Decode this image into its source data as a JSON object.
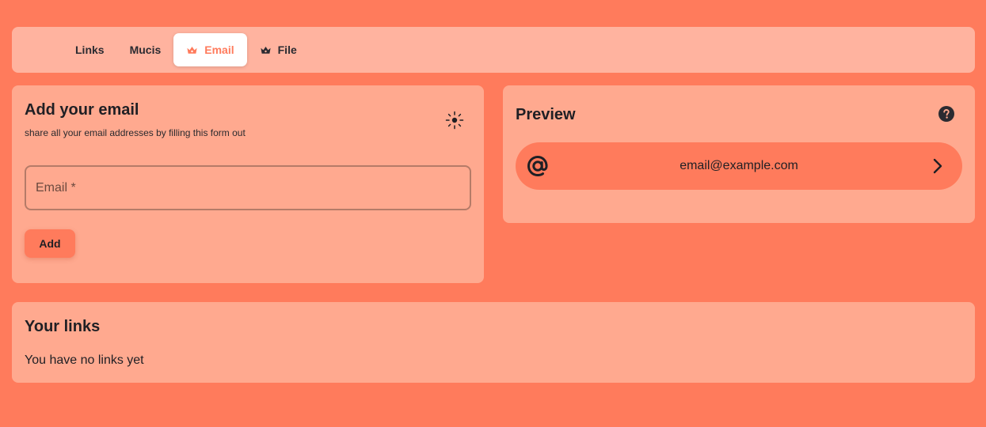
{
  "tabs": [
    {
      "label": "Links",
      "icon": null,
      "active": false
    },
    {
      "label": "Mucis",
      "icon": null,
      "active": false
    },
    {
      "label": "Email",
      "icon": "crown-icon",
      "active": true
    },
    {
      "label": "File",
      "icon": "crown-icon",
      "active": false
    }
  ],
  "form": {
    "title": "Add your email",
    "subtitle": "share all your email addresses by filling this form out",
    "icon": "sun-icon",
    "email_placeholder": "Email *",
    "add_label": "Add"
  },
  "preview": {
    "title": "Preview",
    "help_icon": "help-icon",
    "pill_icon": "at-icon",
    "pill_text": "email@example.com",
    "chevron_icon": "chevron-right-icon"
  },
  "links": {
    "title": "Your links",
    "empty_text": "You have no links yet"
  },
  "colors": {
    "background": "#ff7b5c",
    "card": "#ffa98f",
    "tabbar": "#ffb39f",
    "accent": "#ff7b5c",
    "text": "#1f1f24"
  }
}
